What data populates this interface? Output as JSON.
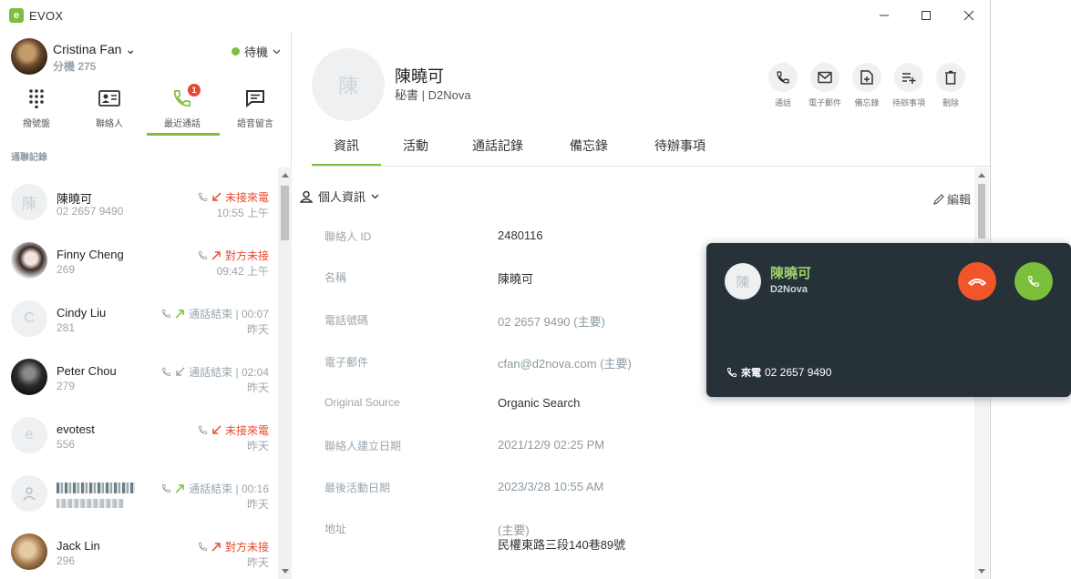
{
  "window": {
    "title": "EVOX"
  },
  "user": {
    "name": "Cristina Fan ⌄",
    "ext": "分機 275",
    "status": "待機"
  },
  "nav": [
    {
      "label": "撥號盤"
    },
    {
      "label": "聯絡人"
    },
    {
      "label": "最近通話",
      "badge": "1"
    },
    {
      "label": "語音留言"
    }
  ],
  "list_section": "通聯記錄",
  "calls": [
    {
      "avatar": "陳",
      "name": "陳曉可",
      "ext": "02 2657 9490",
      "status": "未接來電",
      "time": "10:55 上午"
    },
    {
      "avatar": "",
      "name": "Finny Cheng",
      "ext": "269",
      "status": "對方未接",
      "time": "09:42 上午"
    },
    {
      "avatar": "C",
      "name": "Cindy Liu",
      "ext": "281",
      "status": "通話結束 | 00:07",
      "time": "昨天"
    },
    {
      "avatar": "",
      "name": "Peter Chou",
      "ext": "279",
      "status": "通話結束 | 02:04",
      "time": "昨天"
    },
    {
      "avatar": "e",
      "name": "evotest",
      "ext": "556",
      "status": "未接來電",
      "time": "昨天"
    },
    {
      "avatar": "",
      "name": "",
      "ext": "",
      "status": "通話結束 | 00:16",
      "time": "昨天"
    },
    {
      "avatar": "",
      "name": "Jack Lin",
      "ext": "296",
      "status": "對方未接",
      "time": "昨天"
    }
  ],
  "contact": {
    "avatar": "陳",
    "name": "陳曉可",
    "subtitle": "秘書 | D2Nova",
    "actions": [
      {
        "label": "通話"
      },
      {
        "label": "電子郵件"
      },
      {
        "label": "備忘錄"
      },
      {
        "label": "待辦事項"
      },
      {
        "label": "刪除"
      }
    ],
    "tabs": [
      {
        "label": "資訊"
      },
      {
        "label": "活動"
      },
      {
        "label": "通話記錄"
      },
      {
        "label": "備忘錄"
      },
      {
        "label": "待辦事項"
      }
    ],
    "section_title": "個人資訊",
    "edit_label": "編輯",
    "fields": [
      {
        "label": "聯絡人 ID",
        "value": "2480116"
      },
      {
        "label": "名稱",
        "value": "陳曉可"
      },
      {
        "label": "電話號碼",
        "value": "02 2657 9490 (主要)"
      },
      {
        "label": "電子郵件",
        "value": "cfan@d2nova.com (主要)"
      },
      {
        "label": "Original Source",
        "value": "Organic Search"
      },
      {
        "label": "聯絡人建立日期",
        "value": "2021/12/9 02:25 PM"
      },
      {
        "label": "最後活動日期",
        "value": "2023/3/28 10:55 AM"
      },
      {
        "label": "地址",
        "value": "(主要)",
        "value2": "民權東路三段140巷89號"
      }
    ]
  },
  "incoming": {
    "avatar": "陳",
    "name": "陳曉可",
    "company": "D2Nova",
    "label": "來電",
    "number": "02 2657 9490"
  }
}
